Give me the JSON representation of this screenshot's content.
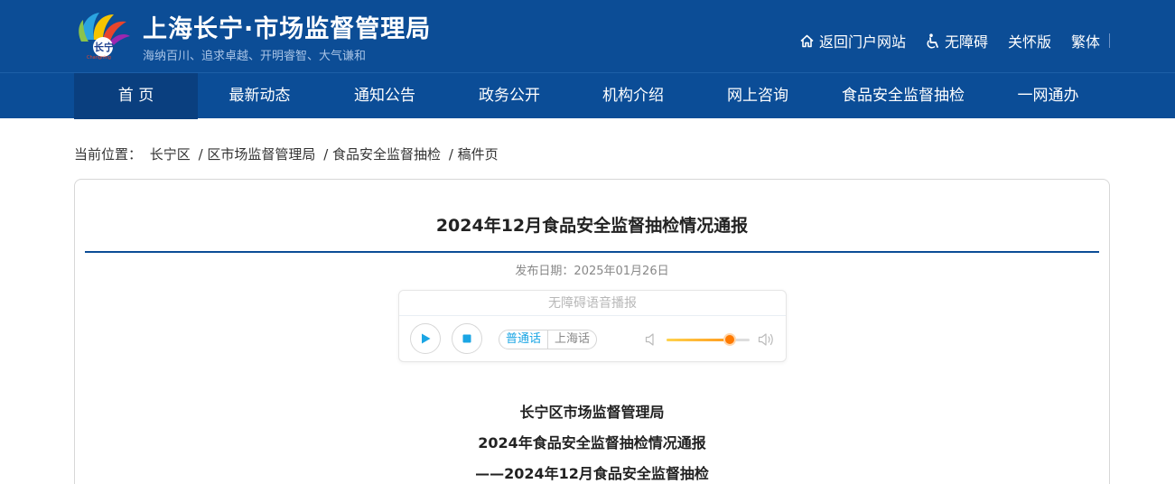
{
  "header": {
    "title": "上海长宁·市场监督管理局",
    "slogan": "海纳百川、追求卓越、开明睿智、大气谦和",
    "logo_icon": "changning-logo-icon",
    "links": [
      {
        "label": "返回门户网站",
        "icon": "home-icon"
      },
      {
        "label": "无障碍",
        "icon": "accessibility-icon"
      },
      {
        "label": "关怀版"
      },
      {
        "label": "繁体"
      }
    ]
  },
  "nav": {
    "items": [
      "首 页",
      "最新动态",
      "通知公告",
      "政务公开",
      "机构介绍",
      "网上咨询",
      "食品安全监督抽检",
      "一网通办"
    ],
    "active_index": 0
  },
  "breadcrumb": {
    "prefix": "当前位置：",
    "items": [
      "长宁区",
      "/ 区市场监督管理局",
      "/ 食品安全监督抽检",
      "/ 稿件页"
    ]
  },
  "article": {
    "title": "2024年12月食品安全监督抽检情况通报",
    "date_label": "发布日期：",
    "date_value": "2025年01月26日",
    "body_lines": [
      "长宁区市场监督管理局",
      "2024年食品安全监督抽检情况通报",
      "——2024年12月食品安全监督抽检"
    ]
  },
  "player": {
    "caption": "无障碍语音播报",
    "languages": [
      "普通话",
      "上海话"
    ],
    "active_language": 0,
    "volume": 0.76,
    "colors": {
      "accent": "#1aa5e4",
      "volume": "#ff7a00"
    }
  },
  "colors": {
    "brand": "#0c4d96",
    "nav_active": "#0a3f7f"
  }
}
